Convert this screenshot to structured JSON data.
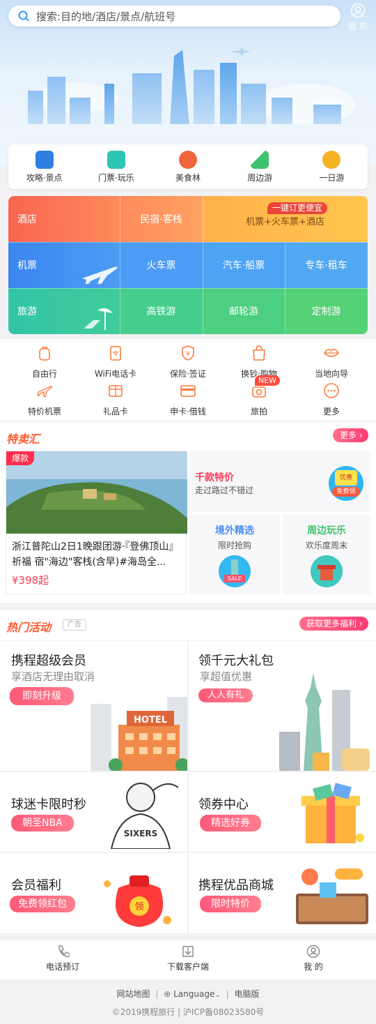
{
  "header": {
    "search_placeholder": "搜索:目的地/酒店/景点/航班号",
    "mine_label": "我 的"
  },
  "quick_nav": [
    {
      "label": "攻略·景点",
      "icon": "guide-book-icon",
      "color": "#2e7fe0"
    },
    {
      "label": "门票·玩乐",
      "icon": "ticket-icon",
      "color": "#2ec4b6"
    },
    {
      "label": "美食林",
      "icon": "food-icon",
      "color": "#f0643c"
    },
    {
      "label": "周边游",
      "icon": "mountain-icon",
      "color": "#3cc46e"
    },
    {
      "label": "一日游",
      "icon": "sun-icon",
      "color": "#f5b223"
    }
  ],
  "grid": {
    "hotel": "酒店",
    "homestay": "民宿·客栈",
    "promo_badge": "一键订更便宜",
    "flight_train_hotel": "机票+火车票+酒店",
    "flight": "机票",
    "train": "火车票",
    "car_ship": "汽车·船票",
    "car_rental": "专车·租车",
    "travel": "旅游",
    "high_speed": "高铁游",
    "cruise": "邮轮游",
    "custom": "定制游"
  },
  "services": [
    {
      "label": "自由行",
      "icon": "backpack-icon"
    },
    {
      "label": "WiFi电话卡",
      "icon": "wifi-card-icon"
    },
    {
      "label": "保险·签证",
      "icon": "shield-icon"
    },
    {
      "label": "换钞·购物",
      "icon": "shopping-bag-icon"
    },
    {
      "label": "当地向导",
      "icon": "guide-lips-icon"
    },
    {
      "label": "特价机票",
      "icon": "plane-icon"
    },
    {
      "label": "礼品卡",
      "icon": "gift-card-icon"
    },
    {
      "label": "申卡·借钱",
      "icon": "credit-card-icon"
    },
    {
      "label": "旅拍",
      "icon": "camera-icon",
      "badge": "NEW"
    },
    {
      "label": "更多",
      "icon": "more-icon"
    }
  ],
  "sale": {
    "title": "特卖汇",
    "more": "更多",
    "main": {
      "tag": "爆款",
      "desc": "浙江普陀山2日1晚跟团游·『登佛顶山』祈福 宿\"海边\"客栈(含早)#海岛全...",
      "price": "¥398起"
    },
    "deal": {
      "title": "千款特价",
      "sub": "走过路过不错过",
      "badge_top": "优惠",
      "badge_bottom": "免费领"
    },
    "abroad": {
      "title": "境外精选",
      "sub": "限时抢购",
      "sale_tag": "SALE"
    },
    "nearby": {
      "title": "周边玩乐",
      "sub": "欢乐度周末"
    }
  },
  "activity": {
    "title": "热门活动",
    "ad": "广告",
    "more": "获取更多福利",
    "tiles": [
      {
        "title": "携程超级会员",
        "sub": "享酒店无理由取消",
        "btn": "即刻升级",
        "sign": "HOTEL"
      },
      {
        "title": "领千元大礼包",
        "sub": "享超值优惠",
        "btn": "人人有礼"
      },
      {
        "title": "球迷卡限时秒",
        "btn": "朝圣NBA",
        "jersey": "SIXERS"
      },
      {
        "title": "领券中心",
        "btn": "精选好券"
      },
      {
        "title": "会员福利",
        "btn": "免费领红包",
        "pouch": "领"
      },
      {
        "title": "携程优品商城",
        "btn": "限时特价"
      }
    ]
  },
  "bottom_bar": [
    {
      "label": "电话预订",
      "icon": "phone-icon"
    },
    {
      "label": "下载客户端",
      "icon": "download-icon"
    },
    {
      "label": "我 的",
      "icon": "user-icon"
    }
  ],
  "footer": {
    "sitemap": "网站地图",
    "language": "Language",
    "desktop": "电脑版",
    "copyright": "©2019携程旅行 | 沪ICP备08023580号"
  }
}
